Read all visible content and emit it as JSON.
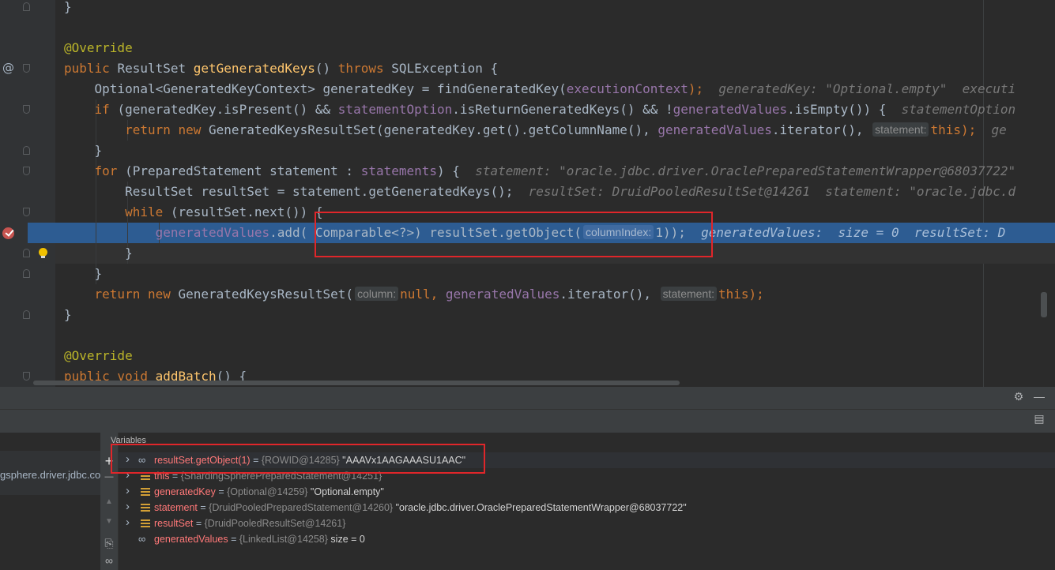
{
  "editor": {
    "lines": [
      {
        "parts": [
          {
            "t": "}",
            "c": "pl"
          }
        ]
      },
      {
        "parts": []
      },
      {
        "parts": [
          {
            "t": "@Override",
            "c": "a"
          }
        ]
      },
      {
        "parts": [
          {
            "t": "public ",
            "c": "k"
          },
          {
            "t": "ResultSet ",
            "c": "pl"
          },
          {
            "t": "getGeneratedKeys",
            "c": "fn"
          },
          {
            "t": "() ",
            "c": "pl"
          },
          {
            "t": "throws ",
            "c": "k"
          },
          {
            "t": "SQLException {",
            "c": "pl"
          }
        ]
      },
      {
        "parts": [
          {
            "t": "    Optional<GeneratedKeyContext> generatedKey = findGeneratedKey(",
            "c": "pl"
          },
          {
            "t": "executionContext",
            "c": "fld"
          },
          {
            "t": ");",
            "c": "k"
          },
          {
            "t": "  generatedKey: \"Optional.empty\"  executi",
            "c": "inl"
          }
        ]
      },
      {
        "parts": [
          {
            "t": "    ",
            "c": "pl"
          },
          {
            "t": "if ",
            "c": "k"
          },
          {
            "t": "(generatedKey.isPresent() && ",
            "c": "pl"
          },
          {
            "t": "statementOption",
            "c": "fld"
          },
          {
            "t": ".isReturnGeneratedKeys() && !",
            "c": "pl"
          },
          {
            "t": "generatedValues",
            "c": "fld"
          },
          {
            "t": ".isEmpty()) {",
            "c": "pl"
          },
          {
            "t": "  statementOption",
            "c": "inl"
          }
        ]
      },
      {
        "parts": [
          {
            "t": "        ",
            "c": "pl"
          },
          {
            "t": "return new ",
            "c": "k"
          },
          {
            "t": "GeneratedKeysResultSet(generatedKey.get().getColumnName(), ",
            "c": "pl"
          },
          {
            "t": "generatedValues",
            "c": "fld"
          },
          {
            "t": ".iterator(), ",
            "c": "pl"
          },
          {
            "t": "statement:",
            "c": "hint"
          },
          {
            "t": "this",
            "c": "k"
          },
          {
            "t": ");",
            "c": "k"
          },
          {
            "t": "  ge",
            "c": "inl"
          }
        ]
      },
      {
        "parts": [
          {
            "t": "    }",
            "c": "pl"
          }
        ]
      },
      {
        "parts": [
          {
            "t": "    ",
            "c": "pl"
          },
          {
            "t": "for ",
            "c": "k"
          },
          {
            "t": "(PreparedStatement statement : ",
            "c": "pl"
          },
          {
            "t": "statements",
            "c": "fld"
          },
          {
            "t": ") {",
            "c": "pl"
          },
          {
            "t": "  statement: \"oracle.jdbc.driver.OraclePreparedStatementWrapper@68037722\"",
            "c": "inl"
          }
        ]
      },
      {
        "parts": [
          {
            "t": "        ResultSet resultSet = statement.getGeneratedKeys();",
            "c": "pl"
          },
          {
            "t": "  resultSet: DruidPooledResultSet@14261  statement: \"oracle.jdbc.d",
            "c": "inl"
          }
        ]
      },
      {
        "parts": [
          {
            "t": "        ",
            "c": "pl"
          },
          {
            "t": "while ",
            "c": "k"
          },
          {
            "t": "(resultSet.next()) {",
            "c": "pl"
          }
        ]
      },
      {
        "parts": [
          {
            "t": "            ",
            "c": "pl"
          },
          {
            "t": "generatedValues",
            "c": "fld"
          },
          {
            "t": ".add( Comparable<?>) resultSet.getObject(",
            "c": "pl"
          },
          {
            "t": "columnIndex:",
            "c": "hint"
          },
          {
            "t": "1));",
            "c": "pl"
          },
          {
            "t": "  generatedValues:  size = 0  resultSet: D",
            "c": "inl"
          }
        ]
      },
      {
        "parts": [
          {
            "t": "        }",
            "c": "pl"
          }
        ]
      },
      {
        "parts": [
          {
            "t": "    }",
            "c": "pl"
          }
        ]
      },
      {
        "parts": [
          {
            "t": "    ",
            "c": "pl"
          },
          {
            "t": "return new ",
            "c": "k"
          },
          {
            "t": "GeneratedKeysResultSet(",
            "c": "pl"
          },
          {
            "t": "column:",
            "c": "hint"
          },
          {
            "t": "null, ",
            "c": "k"
          },
          {
            "t": "generatedValues",
            "c": "fld"
          },
          {
            "t": ".iterator(), ",
            "c": "pl"
          },
          {
            "t": "statement:",
            "c": "hint"
          },
          {
            "t": "this",
            "c": "k"
          },
          {
            "t": ");",
            "c": "k"
          }
        ]
      },
      {
        "parts": [
          {
            "t": "}",
            "c": "pl"
          }
        ]
      },
      {
        "parts": []
      },
      {
        "parts": [
          {
            "t": "@Override",
            "c": "a"
          }
        ]
      },
      {
        "parts": [
          {
            "t": "public void ",
            "c": "k"
          },
          {
            "t": "addBatch",
            "c": "fn"
          },
          {
            "t": "() {",
            "c": "pl"
          }
        ]
      }
    ]
  },
  "gutter": {
    "override_marker": "@",
    "breakpoint_icon": "breakpoint-check-icon",
    "bulb_icon": "lightbulb-icon"
  },
  "debugger": {
    "variables_title": "Variables",
    "frame_text": "gsphere.driver.jdbc.co",
    "variables": [
      {
        "icon": "watch-icon",
        "expandable": true,
        "name": "resultSet.getObject(1)",
        "type": "{ROWID@14285}",
        "value": "\"AAAVx1AAGAAASU1AAC\""
      },
      {
        "icon": "field-icon",
        "expandable": true,
        "name": "this",
        "type": "{ShardingSpherePreparedStatement@14251}",
        "value": ""
      },
      {
        "icon": "field-icon",
        "expandable": true,
        "name": "generatedKey",
        "type": "{Optional@14259}",
        "value": "\"Optional.empty\""
      },
      {
        "icon": "field-icon",
        "expandable": true,
        "name": "statement",
        "type": "{DruidPooledPreparedStatement@14260}",
        "value": "\"oracle.jdbc.driver.OraclePreparedStatementWrapper@68037722\""
      },
      {
        "icon": "field-icon",
        "expandable": true,
        "name": "resultSet",
        "type": "{DruidPooledResultSet@14261}",
        "value": ""
      },
      {
        "icon": "watch-icon",
        "expandable": false,
        "name": "generatedValues",
        "type": "{LinkedList@14258}",
        "value": "size = 0"
      }
    ],
    "toolbar": {
      "add": "+",
      "remove": "—",
      "up": "▲",
      "down": "▼",
      "copy": "⎘",
      "watch": "∞",
      "settings": "⚙",
      "minimize": "—",
      "layout": "▤"
    }
  },
  "colors": {
    "editor_bg": "#2b2b2b",
    "execution_line": "#2d5c92",
    "annotation_box": "#e0262a"
  }
}
